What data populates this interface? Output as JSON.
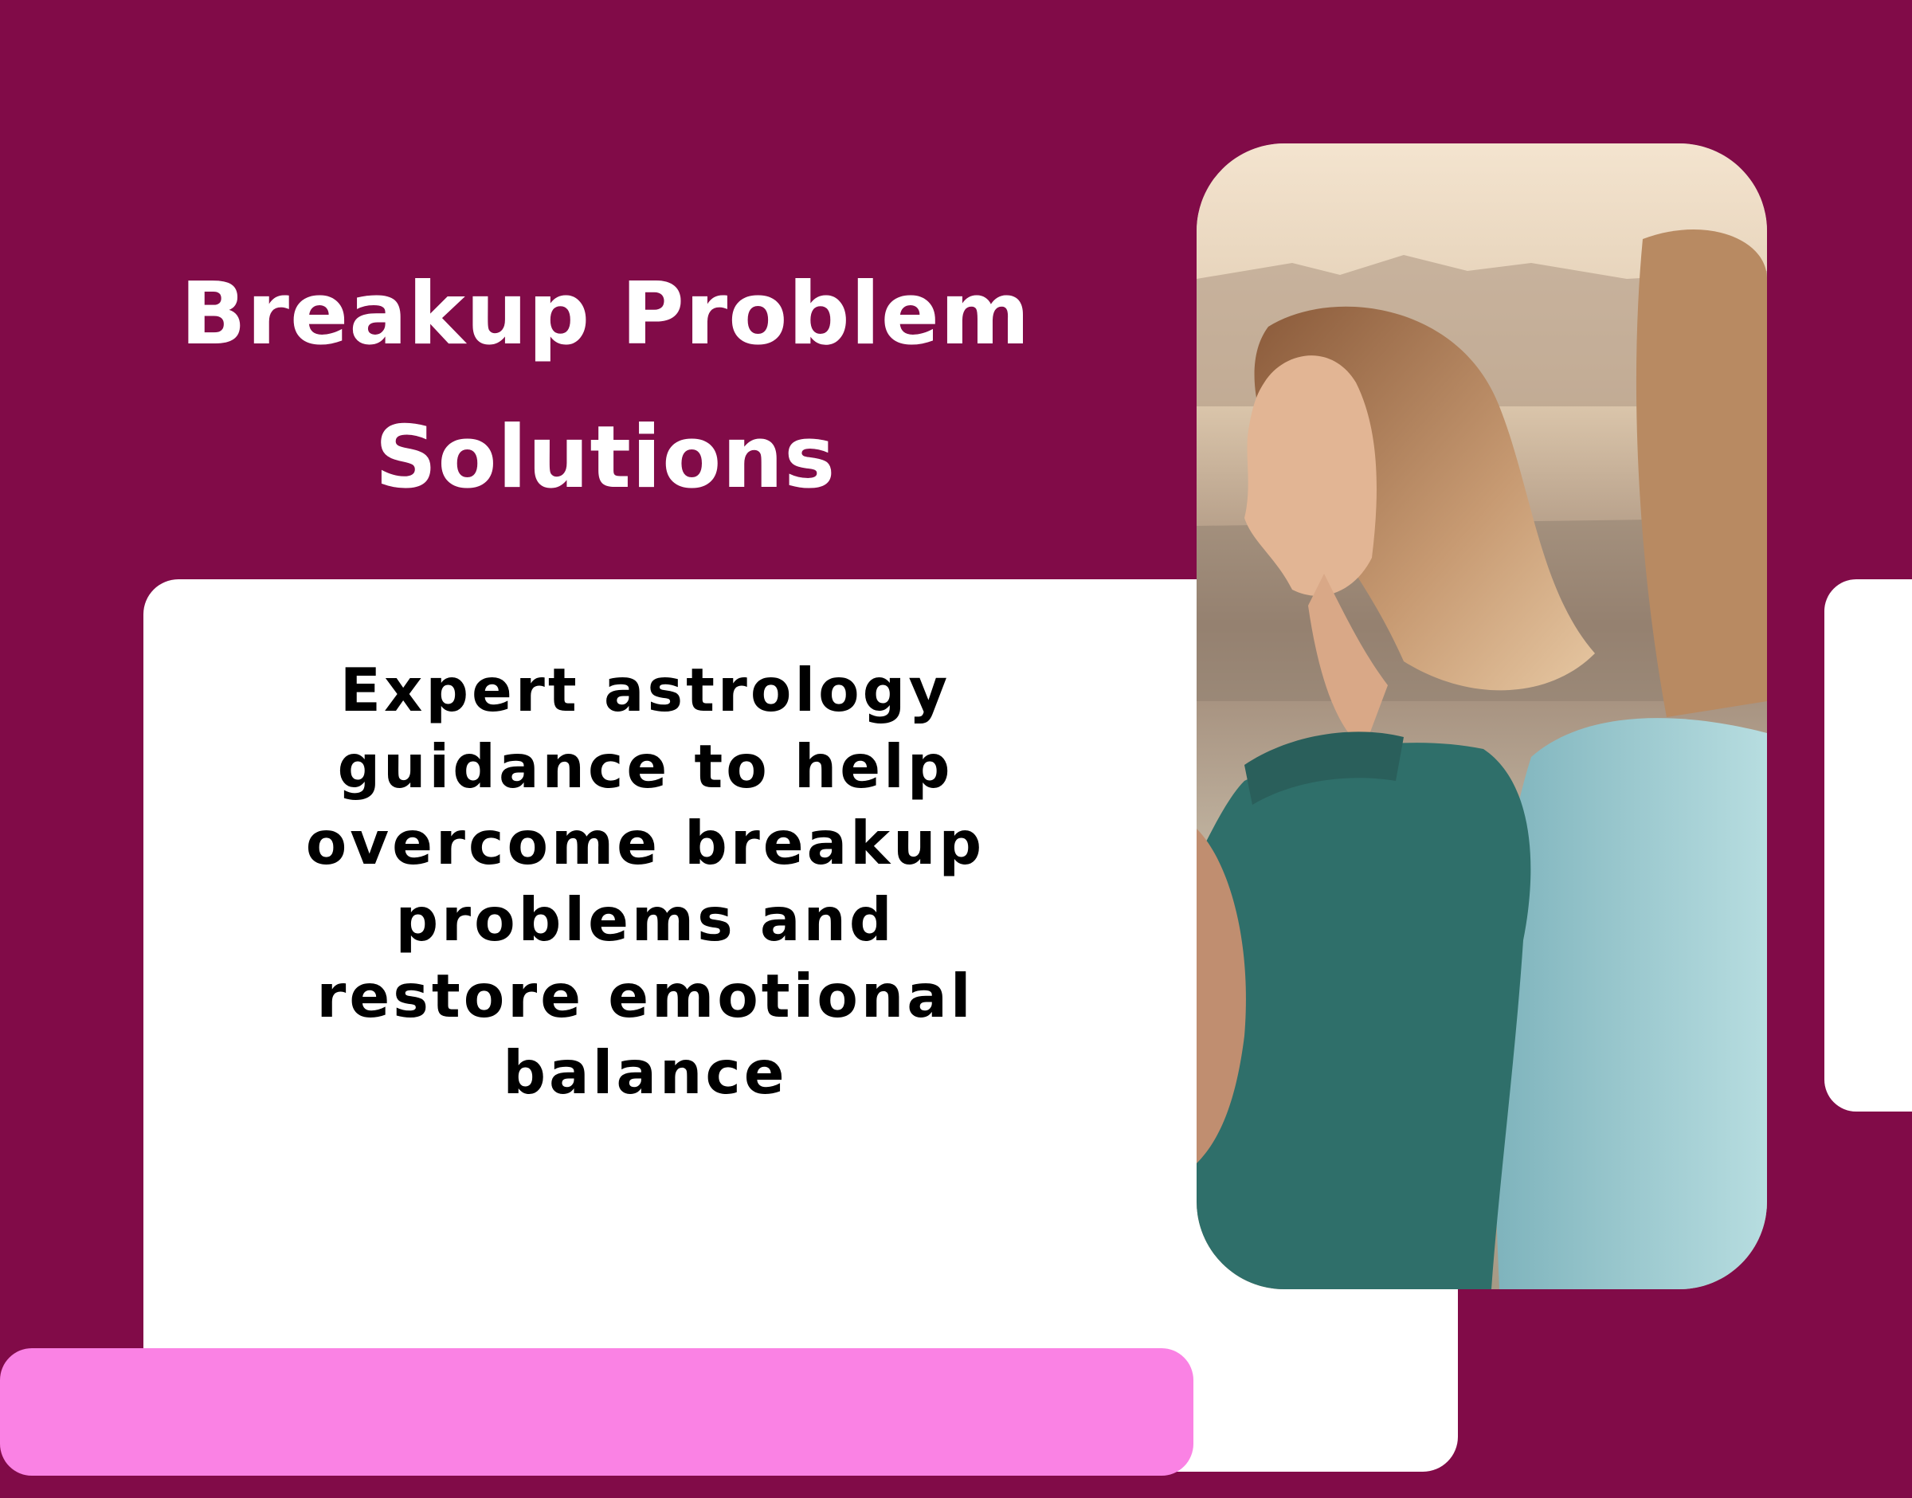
{
  "title_lines": [
    "Breakup Problem",
    "Solutions"
  ],
  "description_lines": [
    "Expert astrology",
    "guidance to help",
    "overcome breakup",
    "problems and",
    "restore emotional",
    "balance"
  ],
  "colors": {
    "background": "#810b48",
    "card": "#ffffff",
    "accent_bar": "#fa82e4",
    "title_text": "#ffffff",
    "body_text": "#000000"
  }
}
